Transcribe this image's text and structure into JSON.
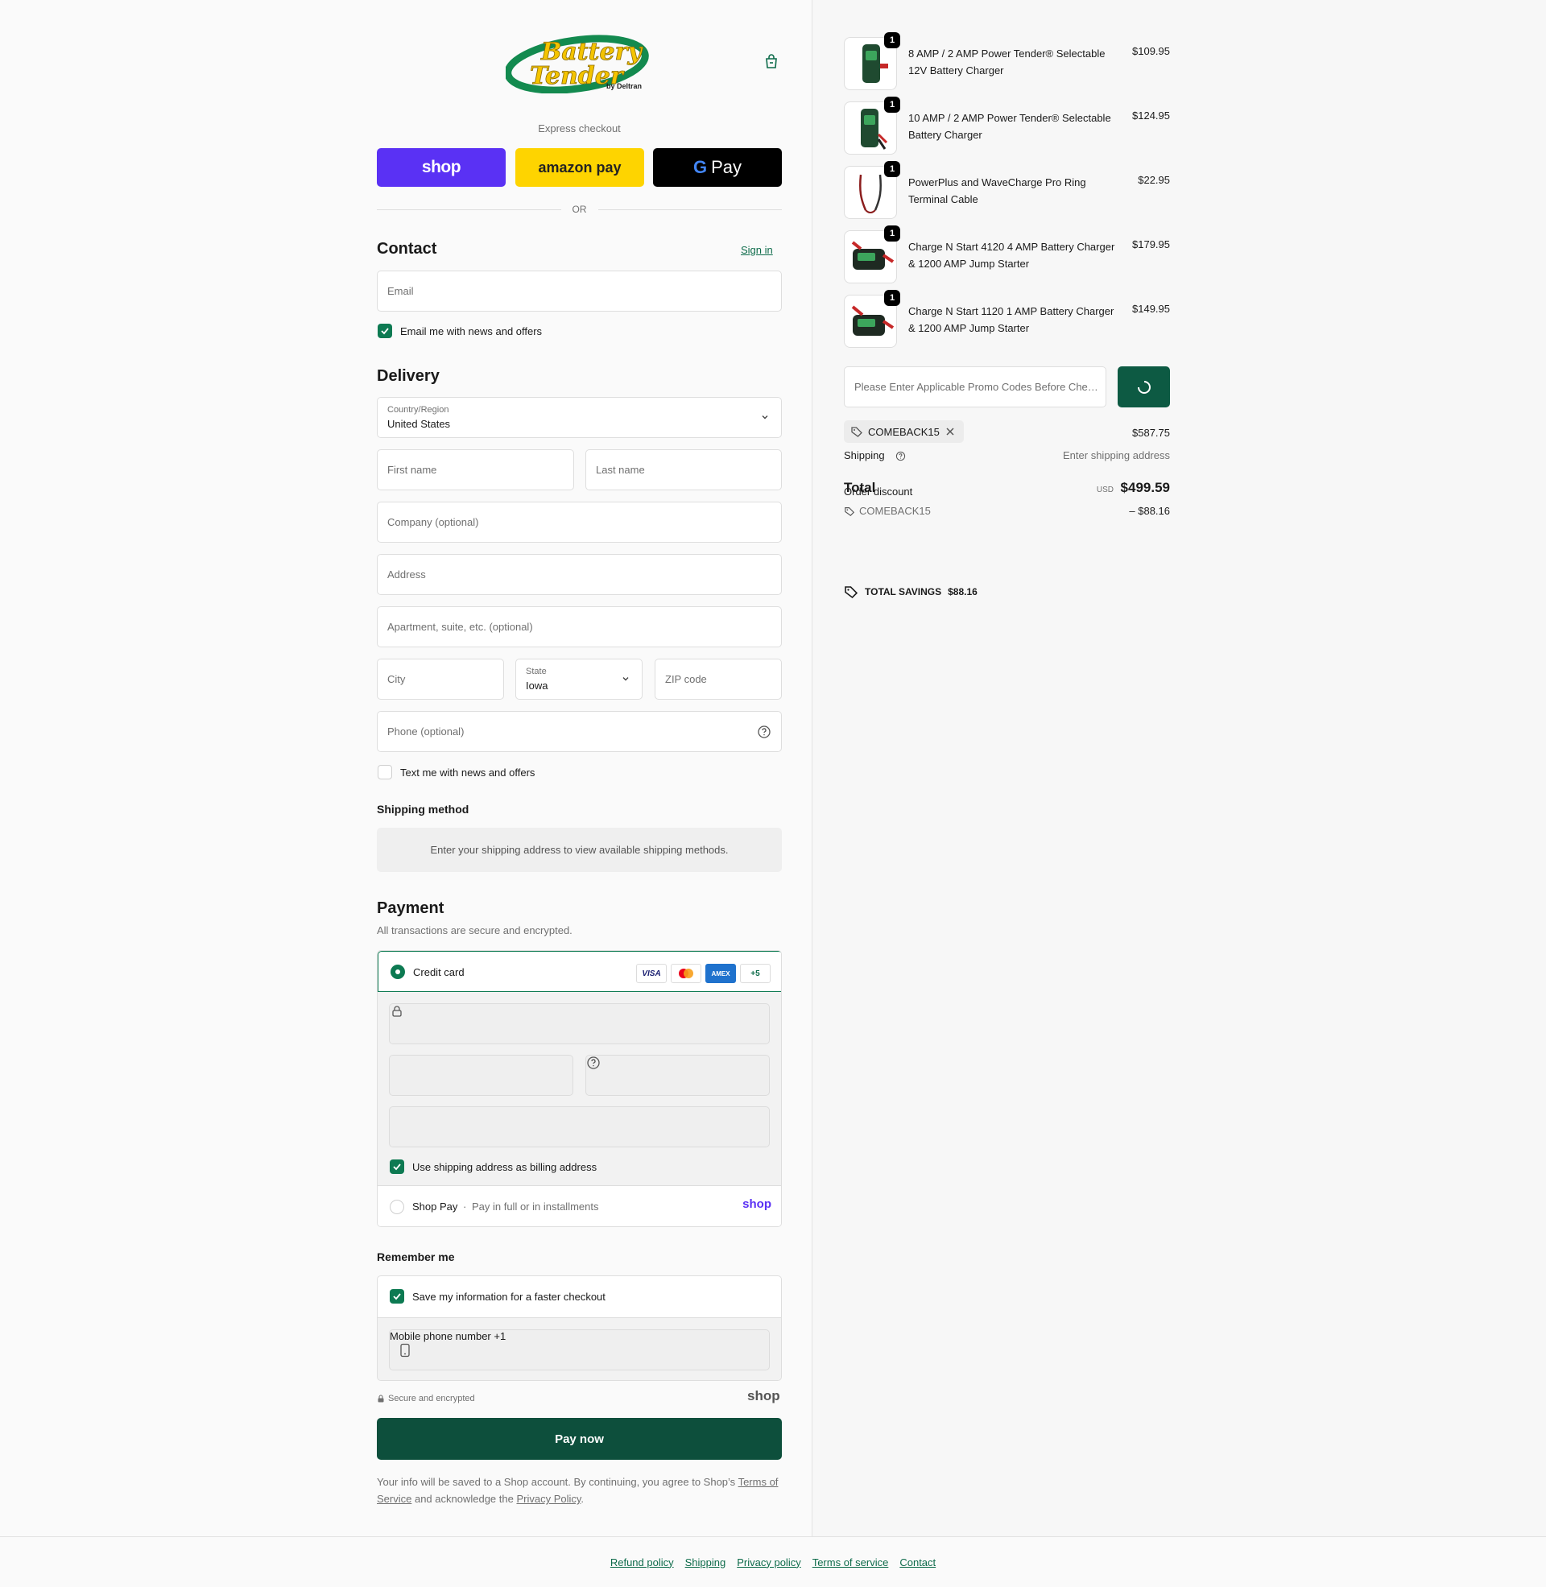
{
  "header": {
    "logo_text_1": "Battery",
    "logo_text_2": "Tender",
    "logo_by": "by Deltran",
    "cart_icon": "shopping-bag-icon"
  },
  "express": {
    "label": "Express checkout",
    "shop_label": "shop",
    "amazon_label": "amazon pay",
    "gpay_label": "Pay",
    "or_label": "OR"
  },
  "contact": {
    "title": "Contact",
    "signin": "Sign in",
    "email_placeholder": "Email",
    "news_label": "Email me with news and offers",
    "news_checked": true
  },
  "delivery": {
    "title": "Delivery",
    "country_label": "Country/Region",
    "country_value": "United States",
    "first_name": "First name",
    "last_name": "Last name",
    "company": "Company (optional)",
    "address": "Address",
    "apartment": "Apartment, suite, etc. (optional)",
    "city": "City",
    "state_label": "State",
    "state_value": "Iowa",
    "zip": "ZIP code",
    "phone": "Phone (optional)",
    "text_label": "Text me with news and offers",
    "text_checked": false
  },
  "shipping_method": {
    "title": "Shipping method",
    "note": "Enter your shipping address to view available shipping methods."
  },
  "payment": {
    "title": "Payment",
    "subtitle": "All transactions are secure and encrypted.",
    "credit_card_label": "Credit card",
    "cards": [
      "VISA",
      "MC",
      "AMEX",
      "+5"
    ],
    "billing_label": "Use shipping address as billing address",
    "billing_checked": true,
    "shoppay_label": "Shop Pay",
    "shoppay_sep": "·",
    "shoppay_sub": "Pay in full or in installments",
    "shoppay_logo": "shop"
  },
  "remember": {
    "title": "Remember me",
    "save_label": "Save my information for a faster checkout",
    "save_checked": true,
    "mobile_label": "Mobile phone number",
    "mobile_value": "+1"
  },
  "secure_label": "Secure and encrypted",
  "shop_mark": "shop",
  "pay_now": "Pay now",
  "legal": {
    "prefix": "Your info will be saved to a Shop account. By continuing, you agree to Shop’s ",
    "terms": "Terms of Service",
    "mid": " and acknowledge the ",
    "privacy": "Privacy Policy",
    "suffix": "."
  },
  "order": {
    "items": [
      {
        "name": "8 AMP / 2 AMP Power Tender® Selectable 12V Battery Charger",
        "price": "$109.95",
        "qty": "1"
      },
      {
        "name": "10 AMP / 2 AMP Power Tender® Selectable Battery Charger",
        "price": "$124.95",
        "qty": "1"
      },
      {
        "name": "PowerPlus and WaveCharge Pro Ring Terminal Cable",
        "price": "$22.95",
        "qty": "1"
      },
      {
        "name": "Charge N Start 4120 4 AMP Battery Charger & 1200 AMP Jump Starter",
        "price": "$179.95",
        "qty": "1"
      },
      {
        "name": "Charge N Start 1120 1 AMP Battery Charger & 1200 AMP Jump Starter",
        "price": "$149.95",
        "qty": "1"
      }
    ],
    "promo_placeholder": "Please Enter Applicable Promo Codes Before Checkout",
    "code": "COMEBACK15",
    "subtotal_value": "$587.75",
    "shipping_label": "Shipping",
    "shipping_value": "Enter shipping address",
    "total_label": "Total",
    "total_currency": "USD",
    "total_value": "$499.59",
    "order_discount_label": "Order discount",
    "discount_code": "COMEBACK15",
    "discount_value": "– $88.16",
    "savings_label": "TOTAL SAVINGS",
    "savings_value": "$88.16"
  },
  "footer": {
    "links": [
      "Refund policy",
      "Shipping",
      "Privacy policy",
      "Terms of service",
      "Contact"
    ]
  },
  "colors": {
    "accent": "#0d7a52",
    "pay_button": "#0d4f3c",
    "shop_purple": "#5a31f4",
    "amazon_yellow": "#fed400"
  }
}
